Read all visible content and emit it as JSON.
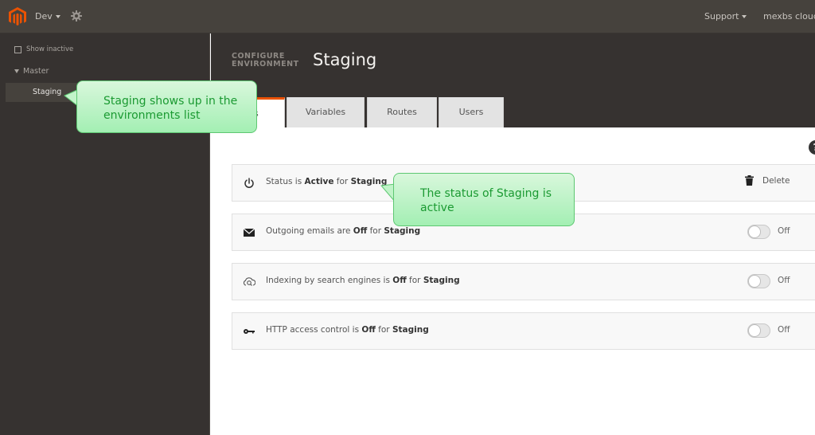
{
  "topbar": {
    "logo_icon": "magento-logo",
    "project_label": "Dev",
    "settings_icon": "gear-icon",
    "support_label": "Support",
    "user_label": "mexbs cloud",
    "brand_color": "#eb5202"
  },
  "sidebar": {
    "show_inactive_label": "Show inactive",
    "show_inactive_checked": false,
    "tree": {
      "parent_label": "Master",
      "children": [
        {
          "label": "Staging",
          "selected": true
        }
      ]
    }
  },
  "header": {
    "configure_line1": "CONFIGURE",
    "configure_line2": "ENVIRONMENT",
    "title": "Staging"
  },
  "tabs": [
    {
      "label": "Settings",
      "visible_text": "gs",
      "active": true
    },
    {
      "label": "Variables",
      "active": false
    },
    {
      "label": "Routes",
      "active": false
    },
    {
      "label": "Users",
      "active": false
    }
  ],
  "help_icon": "?",
  "settings_rows": [
    {
      "icon": "power-icon",
      "prefix": "Status is ",
      "value": "Active",
      "middle": " for ",
      "env": "Staging",
      "action_label": "Delete",
      "action_icon": "trash-icon"
    },
    {
      "icon": "envelope-icon",
      "prefix": "Outgoing emails are ",
      "value": "Off",
      "middle": " for ",
      "env": "Staging",
      "toggle_on": false,
      "toggle_label": "Off"
    },
    {
      "icon": "cloud-search-icon",
      "prefix": "Indexing by search engines is ",
      "value": "Off",
      "middle": " for ",
      "env": "Staging",
      "toggle_on": false,
      "toggle_label": "Off"
    },
    {
      "icon": "key-icon",
      "prefix": "HTTP access control is ",
      "value": "Off",
      "middle": " for ",
      "env": "Staging",
      "toggle_on": false,
      "toggle_label": "Off"
    }
  ],
  "annotations": [
    {
      "line1": "Staging shows up in the",
      "line2": "environments list"
    },
    {
      "line1": "The status of Staging is",
      "line2": "active"
    }
  ]
}
